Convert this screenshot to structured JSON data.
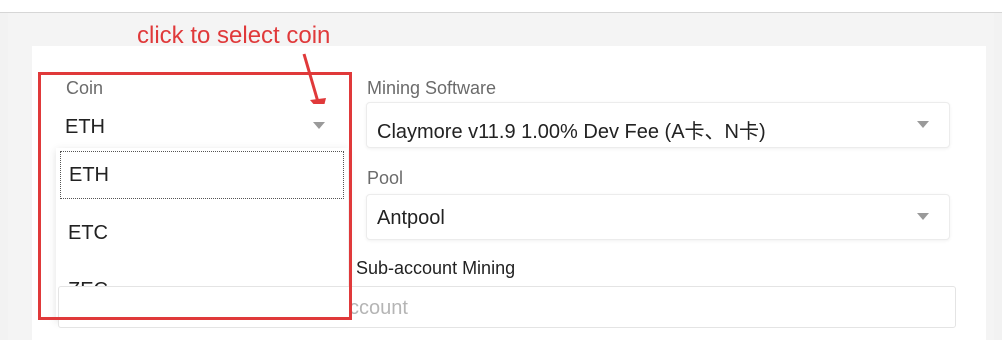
{
  "annotation": {
    "text": "click to select coin",
    "color": "#e0393a"
  },
  "coin": {
    "label": "Coin",
    "selected": "ETH",
    "options": [
      "ETH",
      "ETC",
      "ZEC"
    ]
  },
  "mining_software": {
    "label": "Mining Software",
    "selected": "Claymore v11.9   1.00% Dev Fee  (A卡、N卡)"
  },
  "pool": {
    "label": "Pool",
    "selected": "Antpool"
  },
  "sub_account": {
    "label": "Sub-account Mining",
    "placeholder": "ccount"
  },
  "icons": {
    "caret": "chevron-down-icon"
  }
}
